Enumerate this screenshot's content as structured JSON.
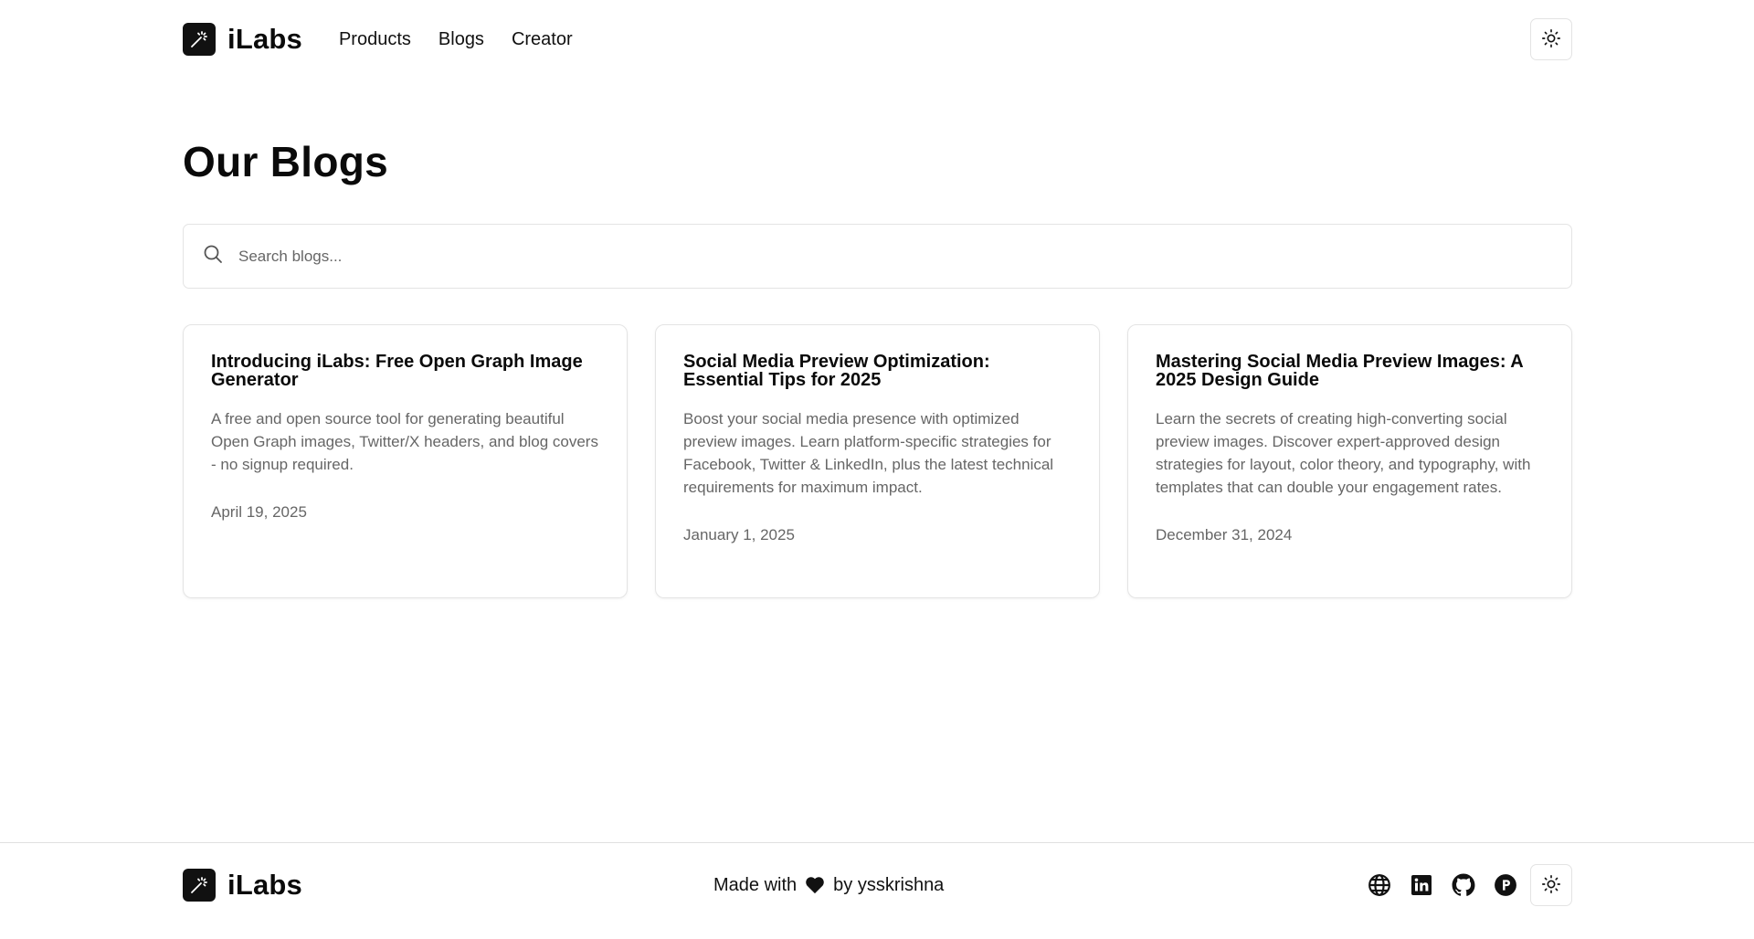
{
  "header": {
    "brand": "iLabs",
    "nav": [
      {
        "label": "Products"
      },
      {
        "label": "Blogs"
      },
      {
        "label": "Creator"
      }
    ]
  },
  "main": {
    "title": "Our Blogs",
    "search": {
      "placeholder": "Search blogs...",
      "value": ""
    },
    "posts": [
      {
        "title": "Introducing iLabs: Free Open Graph Image Generator",
        "description": "A free and open source tool for generating beautiful Open Graph images, Twitter/X headers, and blog covers - no signup required.",
        "date": "April 19, 2025"
      },
      {
        "title": "Social Media Preview Optimization: Essential Tips for 2025",
        "description": "Boost your social media presence with optimized preview images. Learn platform-specific strategies for Facebook, Twitter & LinkedIn, plus the latest technical requirements for maximum impact.",
        "date": "January 1, 2025"
      },
      {
        "title": "Mastering Social Media Preview Images: A 2025 Design Guide",
        "description": "Learn the secrets of creating high-converting social preview images. Discover expert-approved design strategies for layout, color theory, and typography, with templates that can double your engagement rates.",
        "date": "December 31, 2024"
      }
    ]
  },
  "footer": {
    "brand": "iLabs",
    "made_with_prefix": "Made with",
    "made_with_suffix": "by ysskrishna",
    "icons": [
      "globe-icon",
      "linkedin-icon",
      "github-icon",
      "producthunt-icon",
      "sun-icon"
    ]
  },
  "colors": {
    "text": "#0a0a0a",
    "muted": "#666666",
    "border": "#e4e4e4",
    "logo_bg": "#111111"
  }
}
